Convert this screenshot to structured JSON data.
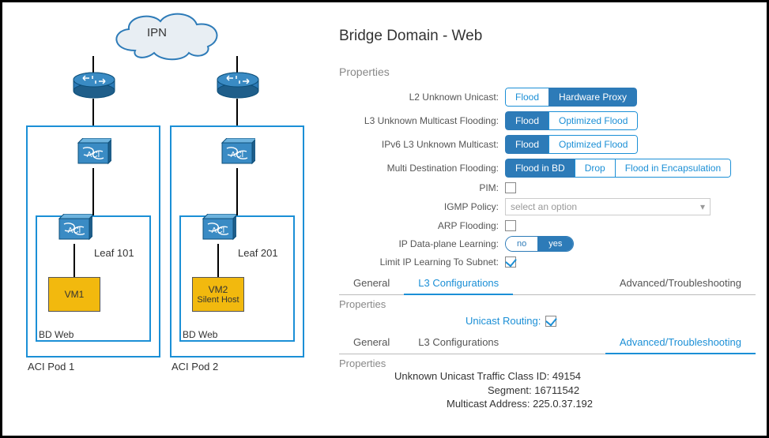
{
  "diagram": {
    "cloud_label": "IPN",
    "pod1": {
      "name": "ACI Pod 1",
      "leaf": "Leaf 101",
      "bd": "BD Web",
      "vm": {
        "line1": "VM1",
        "line2": ""
      }
    },
    "pod2": {
      "name": "ACI Pod 2",
      "leaf": "Leaf 201",
      "bd": "BD Web",
      "vm": {
        "line1": "VM2",
        "line2": "Silent Host"
      }
    }
  },
  "panel": {
    "title": "Bridge Domain - Web",
    "section_props": "Properties",
    "rows": {
      "l2uu": {
        "label": "L2 Unknown Unicast:",
        "opts": [
          "Flood",
          "Hardware Proxy"
        ],
        "sel": 1
      },
      "l3um": {
        "label": "L3 Unknown Multicast Flooding:",
        "opts": [
          "Flood",
          "Optimized Flood"
        ],
        "sel": 0
      },
      "ipv6": {
        "label": "IPv6 L3 Unknown Multicast:",
        "opts": [
          "Flood",
          "Optimized Flood"
        ],
        "sel": 0
      },
      "mdf": {
        "label": "Multi Destination Flooding:",
        "opts": [
          "Flood in BD",
          "Drop",
          "Flood in Encapsulation"
        ],
        "sel": 0
      },
      "pim": {
        "label": "PIM:",
        "checked": false
      },
      "igmp": {
        "label": "IGMP Policy:",
        "placeholder": "select an option"
      },
      "arp": {
        "label": "ARP Flooding:",
        "checked": false
      },
      "ipdp": {
        "label": "IP Data-plane Learning:",
        "opts": [
          "no",
          "yes"
        ],
        "sel": 1
      },
      "limit": {
        "label": "Limit IP Learning To Subnet:",
        "checked": true
      }
    },
    "tabs1": {
      "items": [
        "General",
        "L3 Configurations",
        "Advanced/Troubleshooting"
      ],
      "active": 1
    },
    "sub_props": "Properties",
    "unicast": {
      "label": "Unicast Routing:",
      "checked": true
    },
    "tabs2": {
      "items": [
        "General",
        "L3 Configurations",
        "Advanced/Troubleshooting"
      ],
      "active": 2
    },
    "final_props": "Properties",
    "final": {
      "line1": "Unknown Unicast Traffic Class ID: 49154",
      "line2": "Segment: 16711542",
      "line3": "Multicast Address: 225.0.37.192"
    }
  }
}
